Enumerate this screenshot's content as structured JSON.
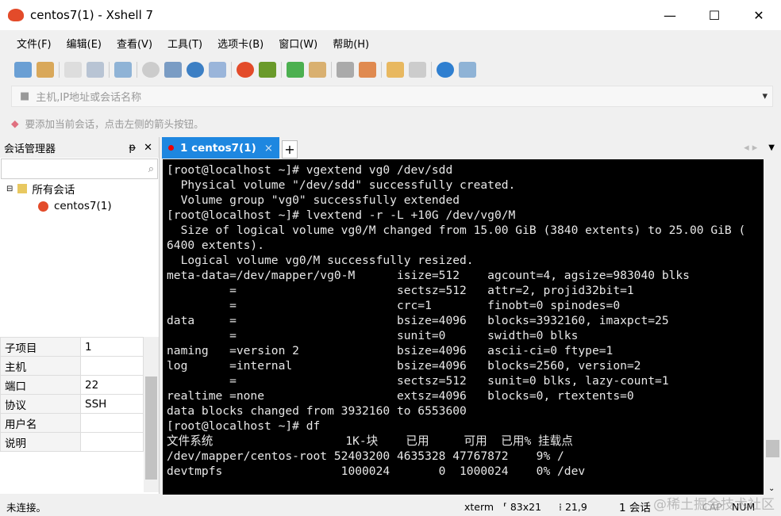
{
  "window": {
    "title": "centos7(1) - Xshell 7",
    "minimize": "—",
    "maximize": "☐",
    "close": "✕"
  },
  "menu": [
    "文件(F)",
    "编辑(E)",
    "查看(V)",
    "工具(T)",
    "选项卡(B)",
    "窗口(W)",
    "帮助(H)"
  ],
  "address": {
    "placeholder": "主机,IP地址或会话名称"
  },
  "hint": "要添加当前会话，点击左侧的箭头按钮。",
  "session_manager": {
    "title": "会话管理器",
    "pin": "ᵽ",
    "close": "✕",
    "search_icon": "⌕",
    "tree": [
      {
        "label": "所有会话"
      },
      {
        "label": "centos7(1)"
      }
    ]
  },
  "properties": [
    [
      "子项目",
      "1"
    ],
    [
      "主机",
      ""
    ],
    [
      "端口",
      "22"
    ],
    [
      "协议",
      "SSH"
    ],
    [
      "用户名",
      ""
    ],
    [
      "说明",
      ""
    ]
  ],
  "tab": {
    "label": "1 centos7(1)",
    "close": "×",
    "add": "+"
  },
  "terminal": [
    "[root@localhost ~]# vgextend vg0 /dev/sdd",
    "  Physical volume \"/dev/sdd\" successfully created.",
    "  Volume group \"vg0\" successfully extended",
    "[root@localhost ~]# lvextend -r -L +10G /dev/vg0/M",
    "  Size of logical volume vg0/M changed from 15.00 GiB (3840 extents) to 25.00 GiB (",
    "6400 extents).",
    "  Logical volume vg0/M successfully resized.",
    "meta-data=/dev/mapper/vg0-M      isize=512    agcount=4, agsize=983040 blks",
    "         =                       sectsz=512   attr=2, projid32bit=1",
    "         =                       crc=1        finobt=0 spinodes=0",
    "data     =                       bsize=4096   blocks=3932160, imaxpct=25",
    "         =                       sunit=0      swidth=0 blks",
    "naming   =version 2              bsize=4096   ascii-ci=0 ftype=1",
    "log      =internal               bsize=4096   blocks=2560, version=2",
    "         =                       sectsz=512   sunit=0 blks, lazy-count=1",
    "realtime =none                   extsz=4096   blocks=0, rtextents=0",
    "data blocks changed from 3932160 to 6553600",
    "[root@localhost ~]# df",
    "文件系统                   1K-块    已用     可用  已用% 挂载点",
    "/dev/mapper/centos-root 52403200 4635328 47767872    9% /",
    "devtmpfs                 1000024       0  1000024    0% /dev"
  ],
  "status": {
    "left": "未连接。",
    "term": "xterm",
    "size": "⸢ 83x21",
    "pos": "⁞ 21,9",
    "sessions": "1 会话",
    "cap": "CAP",
    "num": "NUM"
  },
  "watermark": "@稀土掘金技术社区"
}
